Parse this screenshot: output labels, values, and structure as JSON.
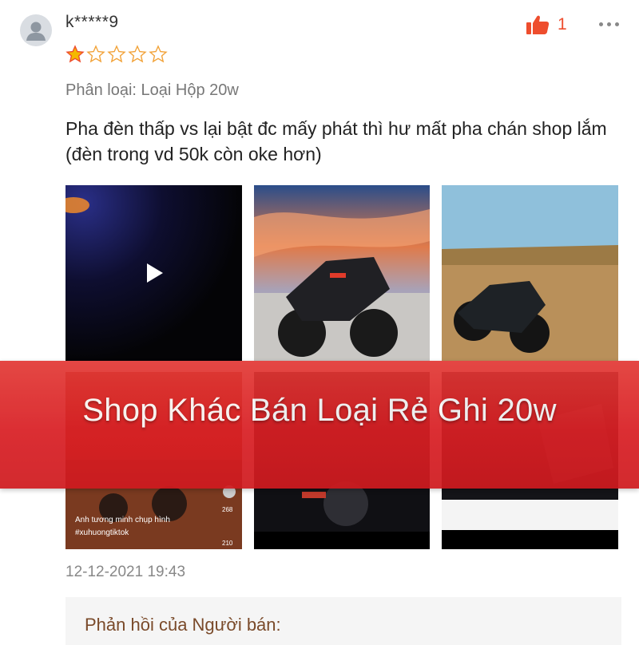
{
  "review": {
    "username": "k*****9",
    "rating": 1,
    "rating_max": 5,
    "like_count": "1",
    "variant": "Phân loại: Loại Hộp  20w",
    "comment": "Pha đèn thấp vs lại bật đc mấy phát thì hư mất pha chán shop lắm (đèn trong vd 50k còn oke hơn)",
    "timestamp": "12-12-2021 19:43"
  },
  "media_overlay": {
    "line1": "Anh tương minh chụp hình",
    "line2": "#xuhuongtiktok",
    "count_a": "268",
    "count_b": "210"
  },
  "banner": {
    "text": "Shop Khác Bán Loại Rẻ Ghi 20w"
  },
  "seller_reply": {
    "title": "Phản hồi của Người bán:"
  },
  "icons": {
    "avatar": "user-avatar-icon",
    "like": "thumbs-up-icon",
    "more": "more-dots-icon",
    "play": "play-icon",
    "star": "star-icon"
  },
  "colors": {
    "star": "#ee4d2d",
    "like": "#ee4d2d",
    "banner": "#d91f24"
  }
}
